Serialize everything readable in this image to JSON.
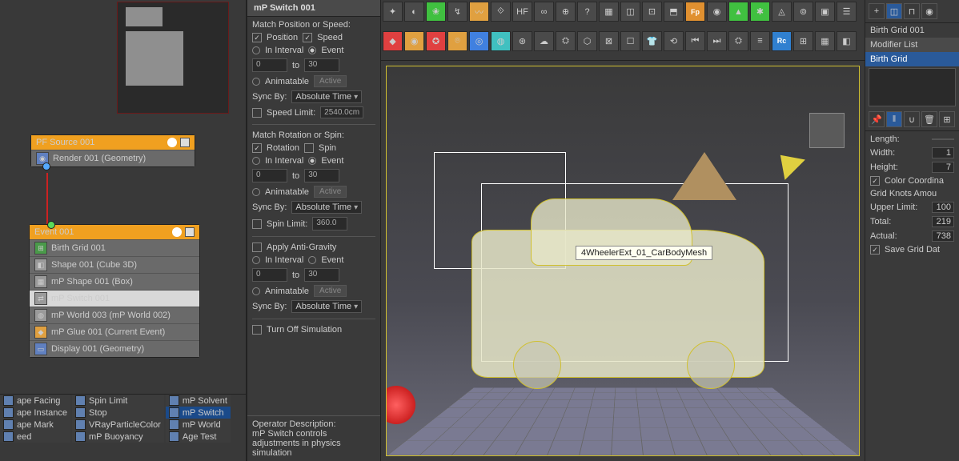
{
  "node_editor": {
    "source": {
      "title": "PF Source 001",
      "row1": "Render 001 (Geometry)"
    },
    "event": {
      "title": "Event 001",
      "rows": [
        "Birth Grid 001",
        "Shape 001 (Cube 3D)",
        "mP Shape 001 (Box)",
        "mP Switch  001",
        "mP World 003 (mP World 002)",
        "mP Glue 001 (Current Event)",
        "Display 001 (Geometry)"
      ],
      "selected_index": 3
    }
  },
  "operators": {
    "col1": [
      "ape Facing",
      "ape Instance",
      "ape Mark",
      "eed"
    ],
    "col2": [
      "Spin Limit",
      "Stop",
      "VRayParticleColor",
      "mP Buoyancy"
    ],
    "col3": [
      "mP Solvent",
      "mP Switch",
      "mP World",
      "Age Test"
    ],
    "selected": "mP Switch"
  },
  "props": {
    "title": "mP Switch  001",
    "section1_label": "Match Position or Speed:",
    "position": "Position",
    "speed": "Speed",
    "in_interval": "In Interval",
    "event": "Event",
    "to_label": "to",
    "num1": "0",
    "num2": "30",
    "animatable": "Animatable",
    "active": "Active",
    "sync_by": "Sync By:",
    "absolute_time": "Absolute Time",
    "speed_limit": "Speed Limit:",
    "speed_limit_val": "2540.0cm",
    "section2_label": "Match Rotation or Spin:",
    "rotation": "Rotation",
    "spin": "Spin",
    "spin_limit": "Spin Limit:",
    "spin_limit_val": "360.0",
    "apply_antigrav": "Apply Anti-Gravity",
    "turn_off": "Turn Off Simulation",
    "op_desc_label": "Operator Description:",
    "op_desc": "mP Switch controls adjustments in physics simulation"
  },
  "viewport": {
    "tooltip": "4WheelerExt_01_CarBodyMesh"
  },
  "modifier": {
    "name": "Birth Grid 001",
    "list_label": "Modifier List",
    "item": "Birth Grid",
    "length_label": "Length:",
    "width_label": "Width:",
    "width_val": "1",
    "height_label": "Height:",
    "height_val": "7",
    "color_coord": "Color Coordina",
    "grid_knots": "Grid Knots Amou",
    "upper_limit": "Upper Limit:",
    "upper_limit_val": "100",
    "total": "Total:",
    "total_val": "219",
    "actual": "Actual:",
    "actual_val": "738",
    "save_grid": "Save Grid Dat"
  },
  "toolbar": {
    "fp": "Fp",
    "rc": "Rc"
  }
}
